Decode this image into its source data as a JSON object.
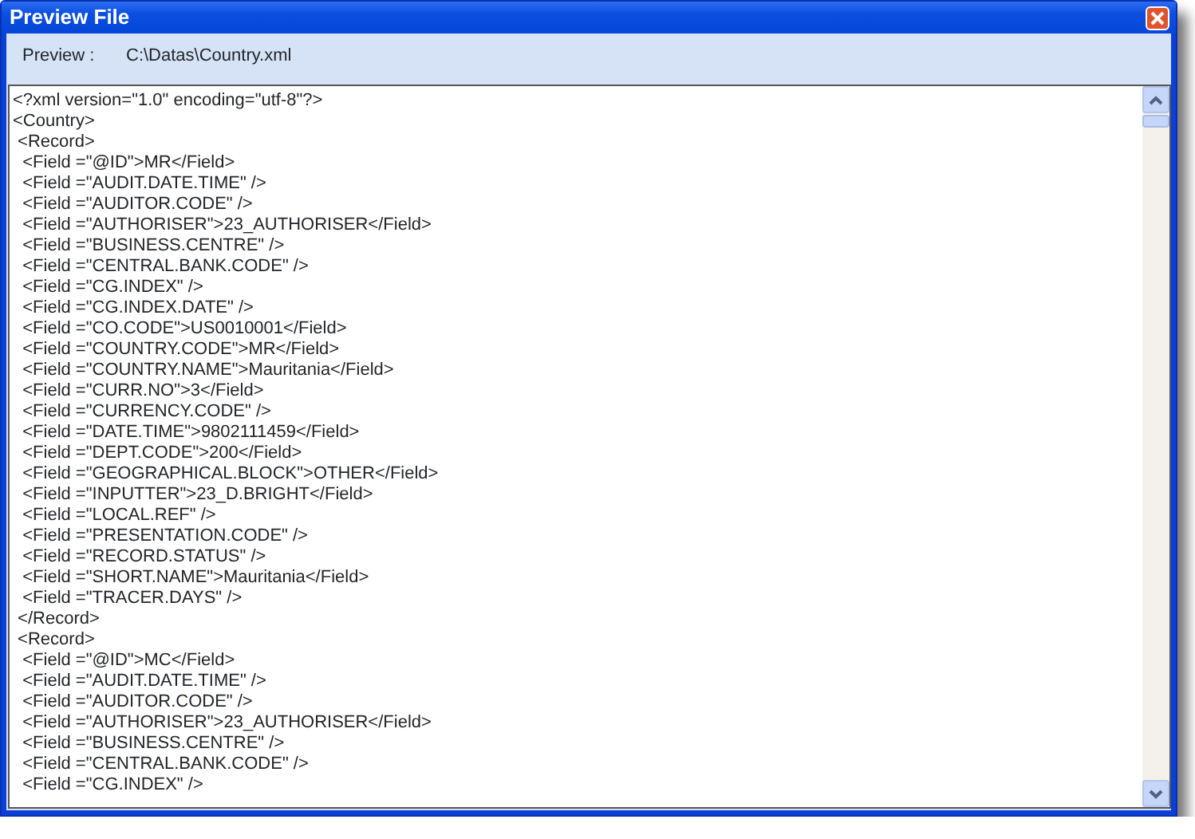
{
  "window": {
    "title": "Preview File"
  },
  "preview": {
    "label": "Preview :",
    "path": "C:\\Datas\\Country.xml"
  },
  "content": {
    "lines": [
      "<?xml version=\"1.0\" encoding=\"utf-8\"?>",
      "<Country>",
      " <Record>",
      "  <Field =\"@ID\">MR</Field>",
      "  <Field =\"AUDIT.DATE.TIME\" />",
      "  <Field =\"AUDITOR.CODE\" />",
      "  <Field =\"AUTHORISER\">23_AUTHORISER</Field>",
      "  <Field =\"BUSINESS.CENTRE\" />",
      "  <Field =\"CENTRAL.BANK.CODE\" />",
      "  <Field =\"CG.INDEX\" />",
      "  <Field =\"CG.INDEX.DATE\" />",
      "  <Field =\"CO.CODE\">US0010001</Field>",
      "  <Field =\"COUNTRY.CODE\">MR</Field>",
      "  <Field =\"COUNTRY.NAME\">Mauritania</Field>",
      "  <Field =\"CURR.NO\">3</Field>",
      "  <Field =\"CURRENCY.CODE\" />",
      "  <Field =\"DATE.TIME\">9802111459</Field>",
      "  <Field =\"DEPT.CODE\">200</Field>",
      "  <Field =\"GEOGRAPHICAL.BLOCK\">OTHER</Field>",
      "  <Field =\"INPUTTER\">23_D.BRIGHT</Field>",
      "  <Field =\"LOCAL.REF\" />",
      "  <Field =\"PRESENTATION.CODE\" />",
      "  <Field =\"RECORD.STATUS\" />",
      "  <Field =\"SHORT.NAME\">Mauritania</Field>",
      "  <Field =\"TRACER.DAYS\" />",
      " </Record>",
      " <Record>",
      "  <Field =\"@ID\">MC</Field>",
      "  <Field =\"AUDIT.DATE.TIME\" />",
      "  <Field =\"AUDITOR.CODE\" />",
      "  <Field =\"AUTHORISER\">23_AUTHORISER</Field>",
      "  <Field =\"BUSINESS.CENTRE\" />",
      "  <Field =\"CENTRAL.BANK.CODE\" />",
      "  <Field =\"CG.INDEX\" />"
    ]
  }
}
